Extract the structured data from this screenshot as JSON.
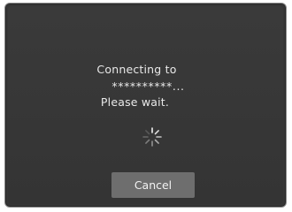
{
  "dialog": {
    "line1": "Connecting to",
    "line2": "**********...",
    "line3": "Please wait.",
    "spinner_icon": "loading-spinner-icon",
    "cancel_label": "Cancel"
  },
  "colors": {
    "background": "#363636",
    "text": "#e9e9e9",
    "button": "#6e6e6e"
  }
}
